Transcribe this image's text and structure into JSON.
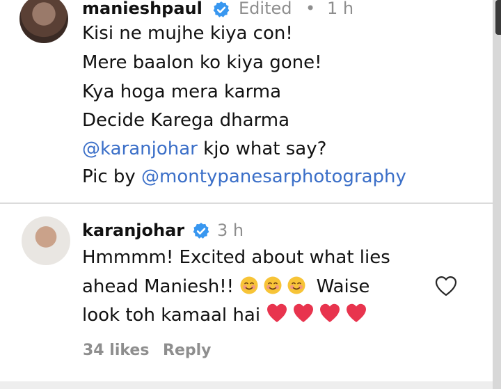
{
  "comment1": {
    "username": "manieshpaul",
    "edited": "Edited",
    "dot": "•",
    "time": "1 h",
    "lines": [
      "Kisi ne mujhe kiya con!",
      "Mere baalon ko kiya gone!",
      "Kya hoga mera karma",
      "Decide Karega dharma"
    ],
    "mention_line": {
      "mention": "@karanjohar",
      "rest": " kjo what say?"
    },
    "pic_line": {
      "prefix": "Pic by ",
      "mention": "@montypanesarphotography"
    }
  },
  "comment2": {
    "username": "karanjohar",
    "time": "3 h",
    "line1": "Hmmmm! Excited about what lies",
    "line2_start": "ahead Maniesh!! ",
    "line2_end": " Waise",
    "line3_start": "look toh kamaal hai ",
    "likes": "34 likes",
    "reply": "Reply"
  },
  "icons": {
    "verified": "verified-badge-icon",
    "smile": "smiling-face-emoji",
    "heart_emoji": "red-heart-emoji",
    "like": "heart-outline-icon"
  },
  "colors": {
    "mention": "#3b6fc8",
    "verified": "#3897f0",
    "meta": "#8e8e8e",
    "heart": "#e8344e"
  }
}
